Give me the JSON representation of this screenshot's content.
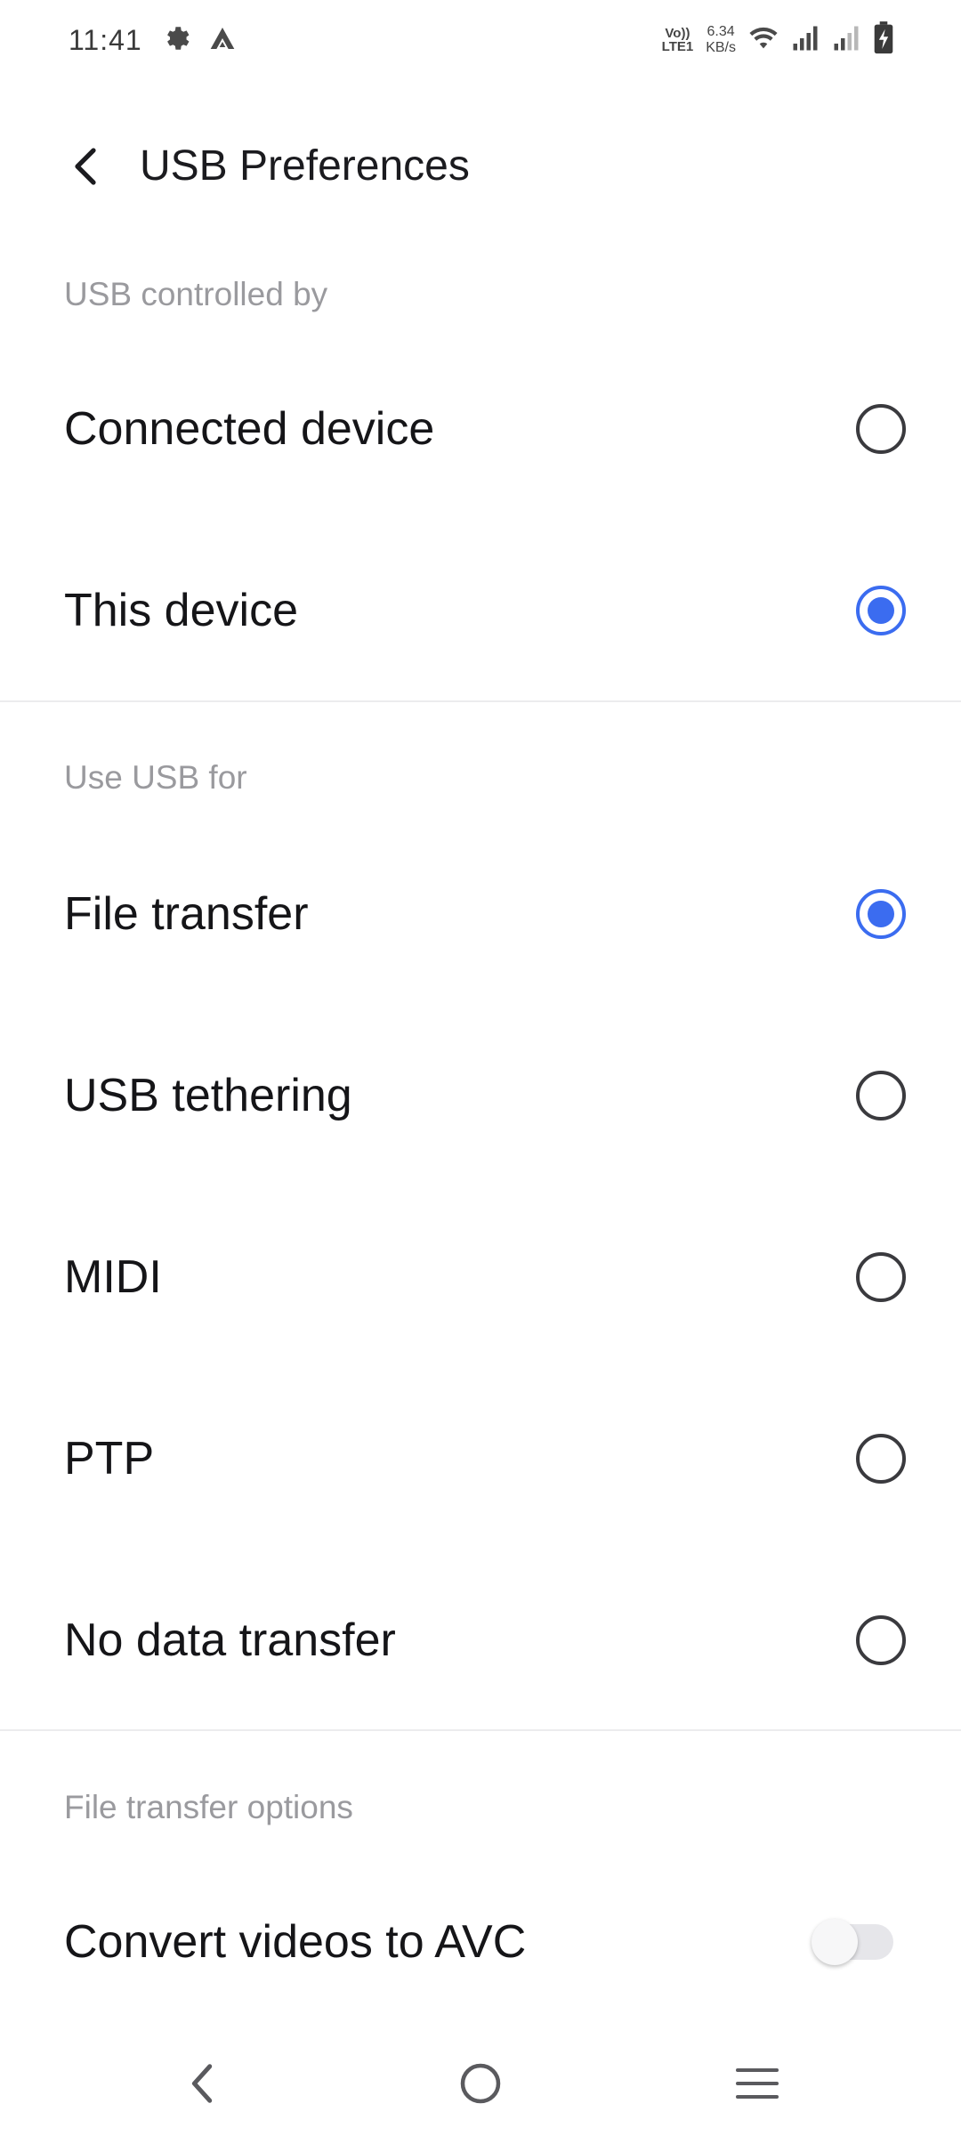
{
  "status_bar": {
    "time": "11:41",
    "volte_top": "Vo))",
    "volte_bottom": "LTE1",
    "speed_value": "6.34",
    "speed_unit": "KB/s",
    "icons": [
      "settings-gear-icon",
      "app-notification-icon",
      "wifi-icon",
      "signal-sim1-icon",
      "signal-sim2-icon",
      "battery-charging-icon"
    ]
  },
  "app_bar": {
    "back_icon": "back-arrow-icon",
    "title": "USB Preferences"
  },
  "sections": [
    {
      "header": "USB controlled by",
      "options": [
        {
          "label": "Connected device",
          "selected": false
        },
        {
          "label": "This device",
          "selected": true
        }
      ]
    },
    {
      "header": "Use USB for",
      "options": [
        {
          "label": "File transfer",
          "selected": true
        },
        {
          "label": "USB tethering",
          "selected": false
        },
        {
          "label": "MIDI",
          "selected": false
        },
        {
          "label": "PTP",
          "selected": false
        },
        {
          "label": "No data transfer",
          "selected": false
        }
      ]
    },
    {
      "header": "File transfer options",
      "toggles": [
        {
          "label": "Convert videos to AVC",
          "enabled": false
        }
      ]
    }
  ],
  "nav_bar": {
    "buttons": [
      "nav-back-icon",
      "nav-home-icon",
      "nav-recents-icon"
    ]
  },
  "colors": {
    "accent": "#3b6cf0",
    "section_header": "#9a9a9e",
    "divider": "#ececee",
    "background": "#ffffff"
  }
}
